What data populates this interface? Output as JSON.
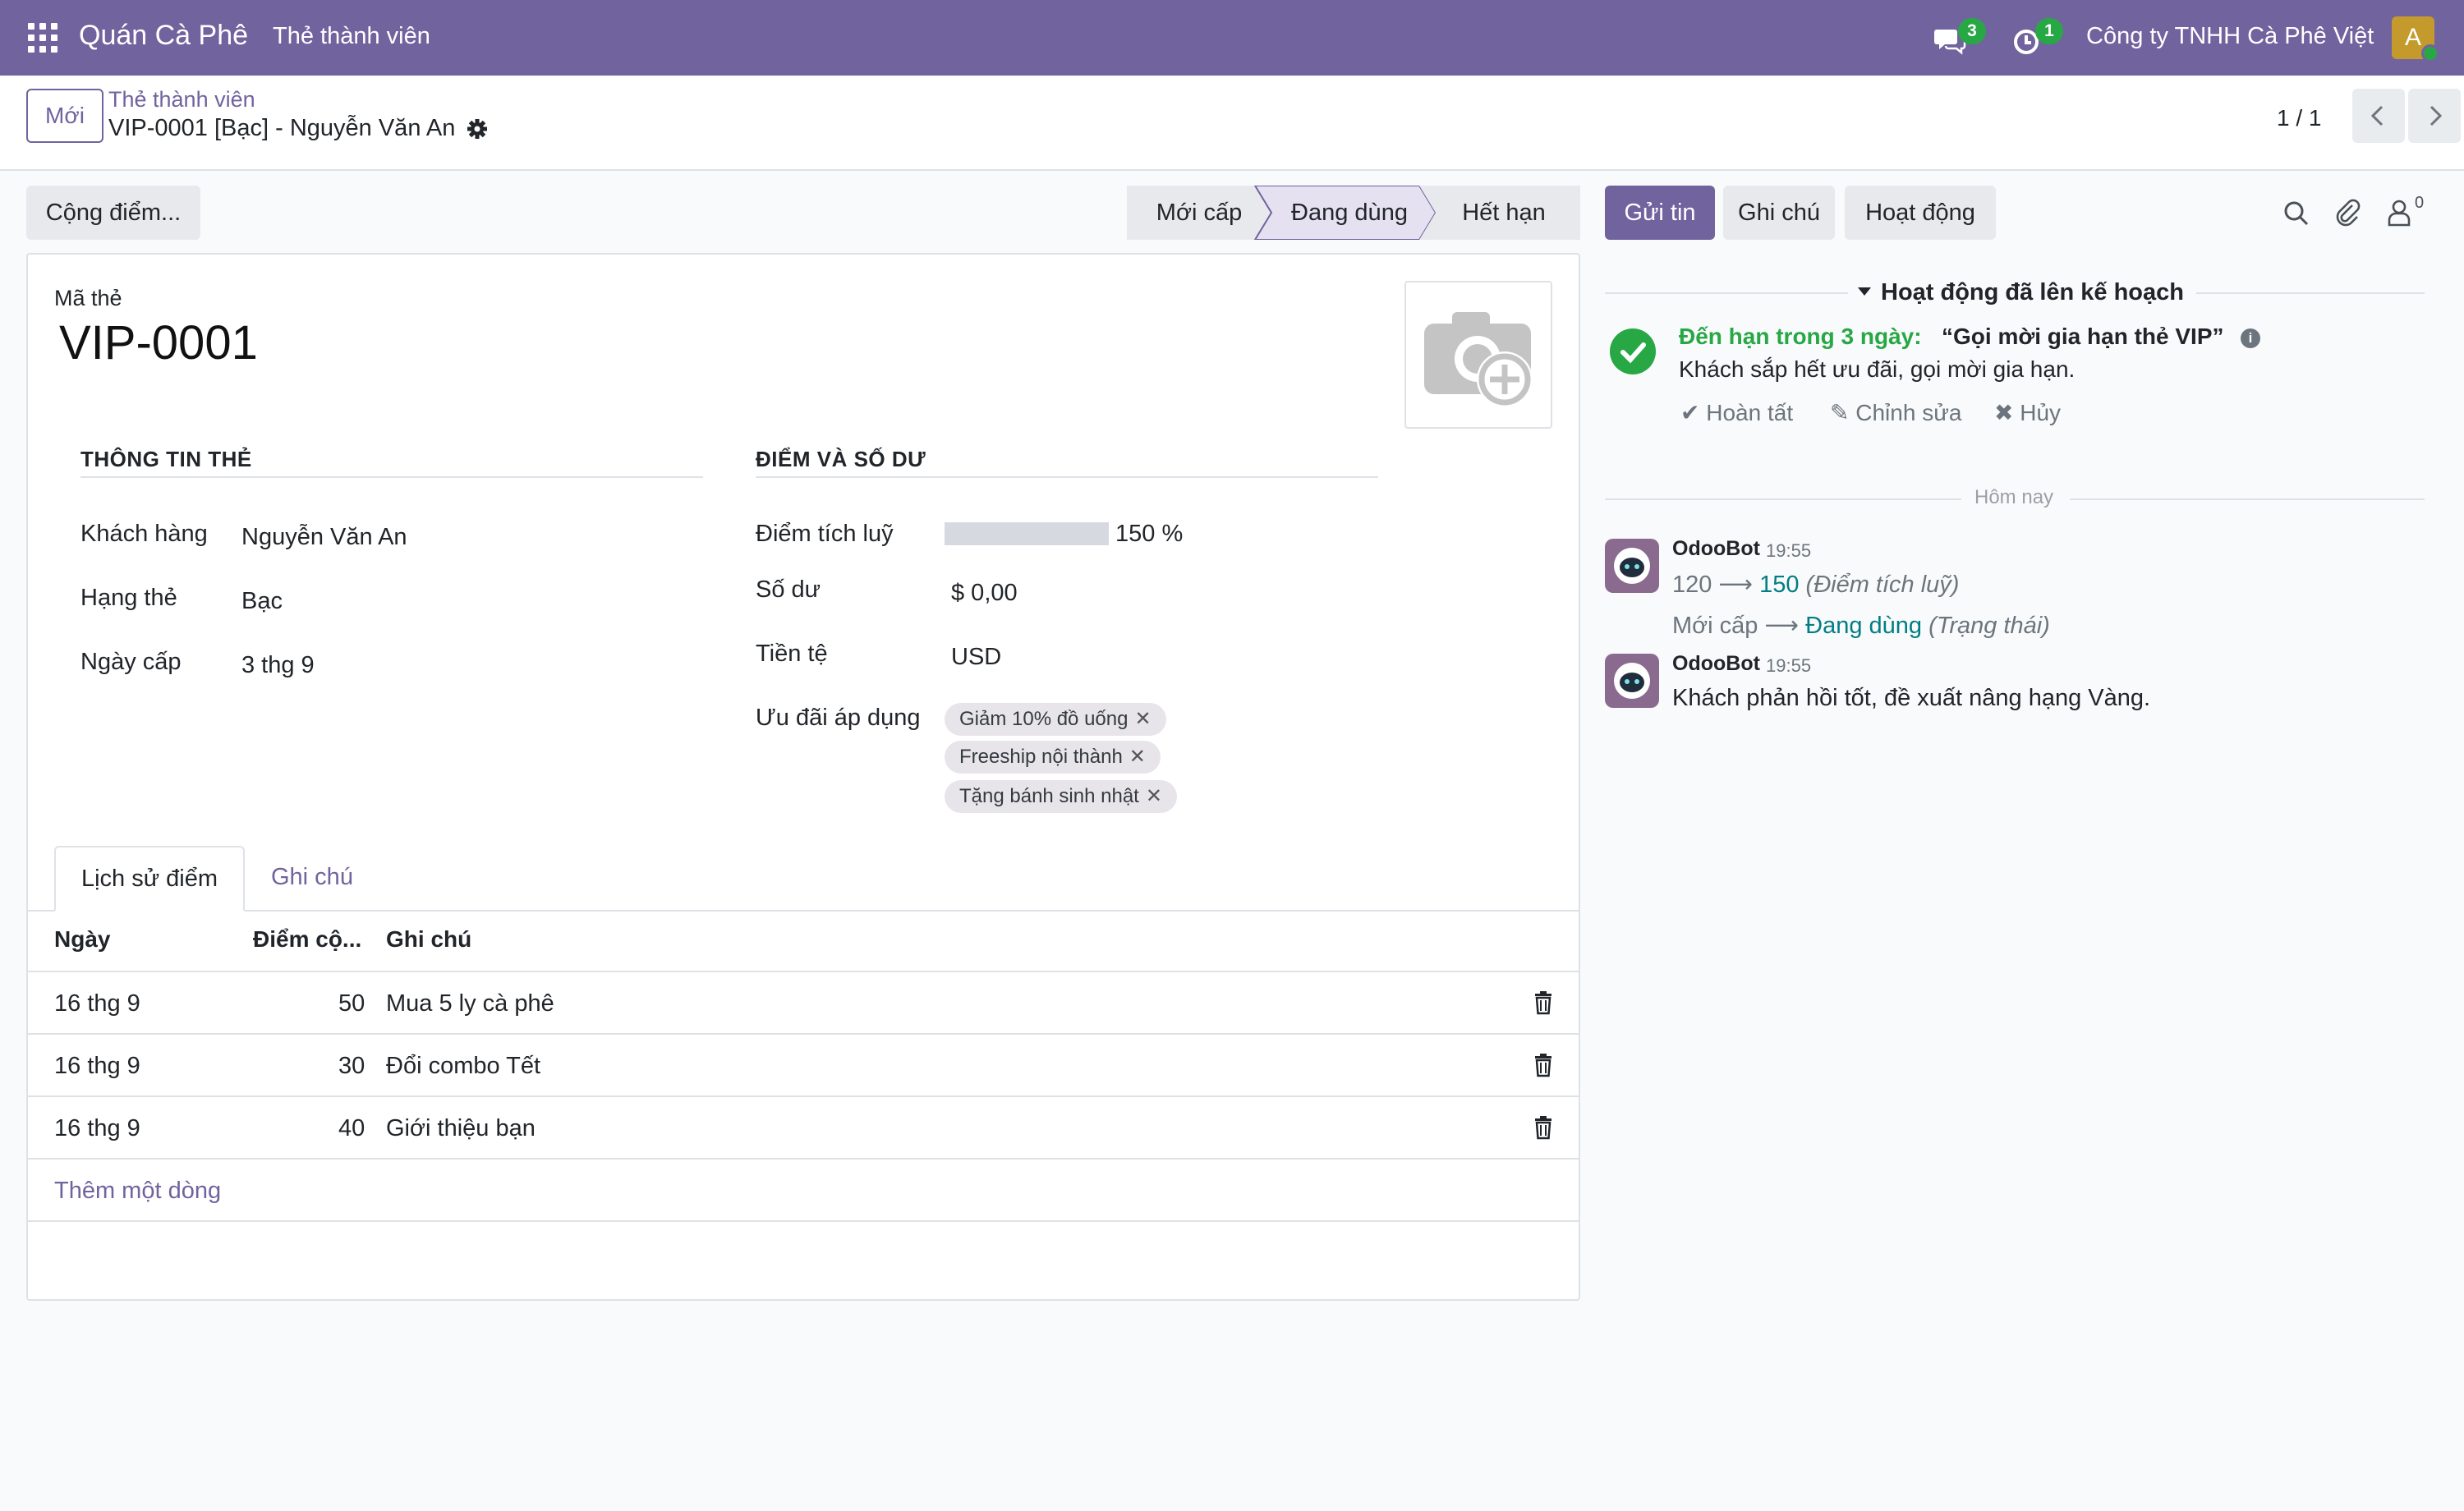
{
  "navbar": {
    "app_name": "Quán Cà Phê",
    "menu": "Thẻ thành viên",
    "messages_count": "3",
    "activities_count": "1",
    "company": "Công ty TNHH Cà Phê Việt",
    "avatar_letter": "A"
  },
  "control": {
    "new_button": "Mới",
    "breadcrumb_parent": "Thẻ thành viên",
    "breadcrumb_current": "VIP-0001 [Bạc] - Nguyễn Văn An",
    "pager": "1 / 1"
  },
  "actions": {
    "add_points": "Cộng điểm..."
  },
  "statusbar": {
    "stages": [
      "Mới cấp",
      "Đang dùng",
      "Hết hạn"
    ],
    "current": "Đang dùng"
  },
  "form": {
    "code_label": "Mã thẻ",
    "code": "VIP-0001",
    "section_card": "THÔNG TIN THẺ",
    "section_points": "ĐIỂM VÀ SỐ DƯ",
    "customer_label": "Khách hàng",
    "customer": "Nguyễn Văn An",
    "tier_label": "Hạng thẻ",
    "tier": "Bạc",
    "issue_label": "Ngày cấp",
    "issue_date": "3 thg 9",
    "points_label": "Điểm tích luỹ",
    "points_percent_text": "150 %",
    "points_fraction": 1.0,
    "balance_label": "Số dư",
    "balance": "$ 0,00",
    "currency_label": "Tiền tệ",
    "currency": "USD",
    "offers_label": "Ưu đãi áp dụng",
    "offers": [
      "Giảm 10% đồ uống",
      "Freeship nội thành",
      "Tặng bánh sinh nhật"
    ]
  },
  "tabs": {
    "history": "Lịch sử điểm",
    "notes": "Ghi chú"
  },
  "table": {
    "headers": [
      "Ngày",
      "Điểm cộ...",
      "Ghi chú"
    ],
    "rows": [
      {
        "date": "16 thg 9",
        "points": "50",
        "note": "Mua 5 ly cà phê"
      },
      {
        "date": "16 thg 9",
        "points": "30",
        "note": "Đổi combo Tết"
      },
      {
        "date": "16 thg 9",
        "points": "40",
        "note": "Giới thiệu bạn"
      }
    ],
    "add_line": "Thêm một dòng"
  },
  "chatter": {
    "send_message": "Gửi tin",
    "log_note": "Ghi chú",
    "activities": "Hoạt động",
    "followers_count": "0",
    "planned_title": "Hoạt động đã lên kế hoạch",
    "activity_due": "Đến hạn trong 3 ngày:",
    "activity_title": "“Gọi mời gia hạn thẻ VIP”",
    "activity_desc": "Khách sắp hết ưu đãi, gọi mời gia hạn.",
    "done": "Hoàn tất",
    "edit": "Chỉnh sửa",
    "cancel": "Hủy",
    "today": "Hôm nay",
    "messages": [
      {
        "author": "OdooBot",
        "time": "19:55",
        "tracking": [
          {
            "old": "120",
            "new": "150",
            "field": "(Điểm tích luỹ)"
          },
          {
            "old": "Mới cấp",
            "new": "Đang dùng",
            "field": "(Trạng thái)"
          }
        ]
      },
      {
        "author": "OdooBot",
        "time": "19:55",
        "body": "Khách phản hồi tốt, đề xuất nâng hạng Vàng."
      }
    ]
  },
  "colors": {
    "brand": "#71639e",
    "success": "#28a745",
    "teal": "#017e84"
  }
}
